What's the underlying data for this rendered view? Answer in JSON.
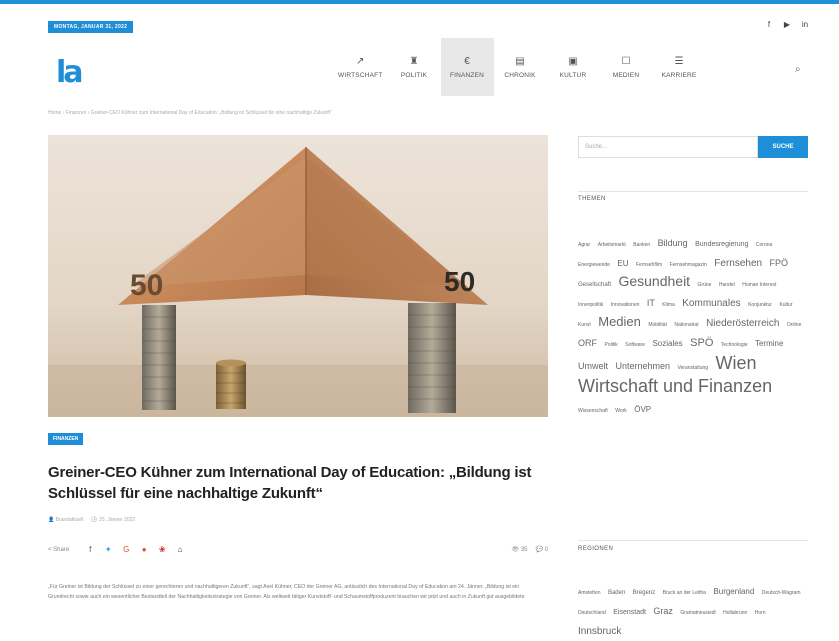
{
  "topbar": {
    "date": "MONTAG, JANUAR 31, 2022",
    "social": [
      "f",
      "▶",
      "in"
    ]
  },
  "logo": {
    "text": "la"
  },
  "nav": {
    "items": [
      {
        "icon": "↗",
        "label": "WIRTSCHAFT",
        "active": false
      },
      {
        "icon": "♜",
        "label": "POLITIK",
        "active": false
      },
      {
        "icon": "€",
        "label": "FINANZEN",
        "active": true
      },
      {
        "icon": "▤",
        "label": "CHRONIK",
        "active": false
      },
      {
        "icon": "▣",
        "label": "KULTUR",
        "active": false
      },
      {
        "icon": "☐",
        "label": "MEDIEN",
        "active": false
      },
      {
        "icon": "☰",
        "label": "KARRIERE",
        "active": false
      }
    ],
    "search_icon": "⌕"
  },
  "breadcrumb": "Home  ›  Finanzen  ›  Greiner-CEO Kühner zum International Day of Education: „Bildung ist Schlüssel für eine nachhaltige Zukunft“",
  "hero": {
    "note_left": "50",
    "note_right": "50"
  },
  "article": {
    "category": "FINANZEN",
    "title": "Greiner-CEO Kühner zum International Day of Education: „Bildung ist Schlüssel für eine nachhaltige Zukunft“",
    "author": "Brandaktuell",
    "date": "25. Jänner 2022",
    "share_label": "Share",
    "share_icons": [
      {
        "glyph": "f",
        "color": "#3b5998"
      },
      {
        "glyph": "✦",
        "color": "#1da1f2"
      },
      {
        "glyph": "G",
        "color": "#dd4b39"
      },
      {
        "glyph": "●",
        "color": "#e64a2e"
      },
      {
        "glyph": "❀",
        "color": "#cb2027"
      },
      {
        "glyph": "⌂",
        "color": "#222222"
      }
    ],
    "views": "35",
    "comments": "0",
    "excerpt": "„Für Greiner ist Bildung der Schlüssel zu einer gerechteren und nachhaltigeren Zukunft“, sagt Axel Kühner, CEO der Greiner AG, anlässlich des International Day of Education am 24. Jänner. „Bildung ist ein Grundrecht sowie auch ein wesentlicher Bestandteil der Nachhaltigkeitsstrategie von Greiner. Als weltweit tätiger Kunststoff- und Schaumstoffproduzent brauchen wir jetzt und auch in Zukunft gut ausgebildete"
  },
  "sidebar": {
    "search_placeholder": "Suche...",
    "search_button": "SUCHE",
    "themes_heading": "THEMEN",
    "themes": [
      {
        "text": "Agrar",
        "size": 5
      },
      {
        "text": "Arbeitsmarkt",
        "size": 5
      },
      {
        "text": "Banken",
        "size": 5
      },
      {
        "text": "Bildung",
        "size": 9
      },
      {
        "text": "Bundesregierung",
        "size": 7
      },
      {
        "text": "Corona",
        "size": 5
      },
      {
        "text": "Energiewende",
        "size": 5
      },
      {
        "text": "EU",
        "size": 8
      },
      {
        "text": "Fernsehfilm",
        "size": 5
      },
      {
        "text": "Fernsehmagazin",
        "size": 5
      },
      {
        "text": "Fernsehen",
        "size": 10
      },
      {
        "text": "FPÖ",
        "size": 9
      },
      {
        "text": "Gesellschaft",
        "size": 6
      },
      {
        "text": "Gesundheit",
        "size": 14
      },
      {
        "text": "Grüne",
        "size": 5
      },
      {
        "text": "Handel",
        "size": 5
      },
      {
        "text": "Human Interest",
        "size": 5
      },
      {
        "text": "Innenpolitik",
        "size": 5
      },
      {
        "text": "Innovationen",
        "size": 5
      },
      {
        "text": "IT",
        "size": 9
      },
      {
        "text": "Klima",
        "size": 5
      },
      {
        "text": "Kommunales",
        "size": 10
      },
      {
        "text": "Konjunktur",
        "size": 5
      },
      {
        "text": "Kultur",
        "size": 5
      },
      {
        "text": "Kunst",
        "size": 5
      },
      {
        "text": "Medien",
        "size": 13
      },
      {
        "text": "Mobilität",
        "size": 5
      },
      {
        "text": "Nationalrat",
        "size": 5
      },
      {
        "text": "Niederösterreich",
        "size": 10
      },
      {
        "text": "Online",
        "size": 5
      },
      {
        "text": "ORF",
        "size": 9
      },
      {
        "text": "Politik",
        "size": 5
      },
      {
        "text": "Software",
        "size": 5
      },
      {
        "text": "Soziales",
        "size": 8
      },
      {
        "text": "SPÖ",
        "size": 11
      },
      {
        "text": "Technologie",
        "size": 5
      },
      {
        "text": "Termine",
        "size": 8
      },
      {
        "text": "Umwelt",
        "size": 9
      },
      {
        "text": "Unternehmen",
        "size": 9
      },
      {
        "text": "Veranstaltung",
        "size": 5
      },
      {
        "text": "Wien",
        "size": 18
      },
      {
        "text": "Wirtschaft und Finanzen",
        "size": 18
      },
      {
        "text": "Wissenschaft",
        "size": 5
      },
      {
        "text": "Work",
        "size": 5
      },
      {
        "text": "ÖVP",
        "size": 8
      }
    ],
    "regions_heading": "REGIONEN",
    "regions": [
      {
        "text": "Amstetten",
        "size": 5
      },
      {
        "text": "Baden",
        "size": 6
      },
      {
        "text": "Bregenz",
        "size": 6
      },
      {
        "text": "Bruck an der Leitha",
        "size": 5
      },
      {
        "text": "Burgenland",
        "size": 8
      },
      {
        "text": "Deutsch-Wagram",
        "size": 5
      },
      {
        "text": "Deutschland",
        "size": 5
      },
      {
        "text": "Eisenstadt",
        "size": 7
      },
      {
        "text": "Graz",
        "size": 9
      },
      {
        "text": "Gramatneusiedl",
        "size": 5
      },
      {
        "text": "Hollabrunn",
        "size": 5
      },
      {
        "text": "Horn",
        "size": 5
      },
      {
        "text": "Innsbruck",
        "size": 10
      }
    ]
  }
}
